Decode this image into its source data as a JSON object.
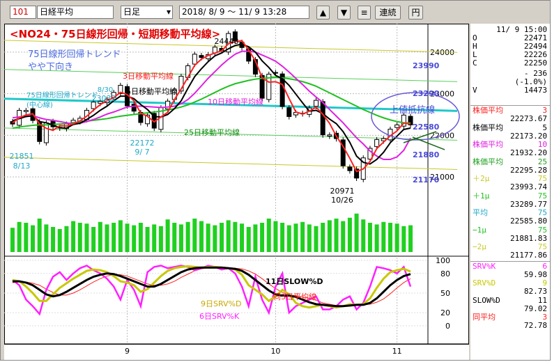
{
  "toolbar": {
    "code": "101",
    "name": "日経平均",
    "period": "日足",
    "range": "2018/ 8/ 9 〜 11/ 9 13:28",
    "up_label": "▲",
    "down_label": "▼",
    "menu_label": "≡",
    "continuous_label": "連続",
    "yen_label": "円"
  },
  "chart_titles": {
    "main": "<NO24・75日線形回帰・短期移動平均線>",
    "trend1": "75日線形回帰トレンド",
    "trend2": "やや下向き"
  },
  "annotations": {
    "ma3": "3日移動平均線",
    "ma5": "5日移動平均線",
    "ma10": "10日移動平均線",
    "ma25": "25日移動平均線",
    "reg_center1": "75日線形回帰トレンド",
    "reg_center2": "(中心線)",
    "resistance": "上値抵抗線",
    "high_price": "24448",
    "low_price": "20971",
    "low_date": "10/26",
    "p21851": "21851",
    "d0813": "8/13",
    "p23032": "23032",
    "d0830": "8/30",
    "p22172": "22172",
    "d0907": "9/ 7",
    "lvl_23990": "23990",
    "lvl_23290": "23290",
    "lvl_22580": "22580",
    "lvl_21880": "21880",
    "lvl_21170": "21170",
    "slow_d": "11日SLOW%D",
    "same3": "同3日平均線",
    "srv_d": "9日SRV%D",
    "srv_k": "6日SRV%K"
  },
  "axis": {
    "price_ticks": [
      "24000",
      "23000",
      "22000",
      "21000"
    ],
    "osc_ticks": [
      "100",
      "80",
      "50",
      "20",
      "0"
    ],
    "months": [
      "9",
      "10",
      "11"
    ]
  },
  "colors": {
    "candle_up": "#ffffff",
    "candle_down": "#000000",
    "ma3": "#ff2020",
    "ma5": "#000000",
    "ma10": "#e020e0",
    "ma25": "#20c020",
    "regression": "#20c8c8",
    "band_outer": "#c8c828",
    "band_inner": "#58d058",
    "volume": "#20d020",
    "slow_d": "#000000",
    "srv_d": "#c8c800",
    "srv_k": "#ff20ff",
    "same3": "#ff2020"
  },
  "panel": {
    "date": "11/ 9 15:00",
    "ohlc": [
      {
        "k": "O",
        "v": "22471"
      },
      {
        "k": "H",
        "v": "22494"
      },
      {
        "k": "L",
        "v": "22226"
      },
      {
        "k": "C",
        "v": "22250"
      }
    ],
    "chg": "- 236",
    "chg_pct": "(-1.0%)",
    "vol_k": "V",
    "vol": "14473",
    "items": [
      {
        "label": "株価平均",
        "period": "3",
        "value": "22273.67",
        "color": "#ff2020"
      },
      {
        "label": "株価平均",
        "period": "5",
        "value": "22173.20",
        "color": "#000000"
      },
      {
        "label": "株価平均",
        "period": "10",
        "value": "21932.20",
        "color": "#e020e0"
      },
      {
        "label": "株価平均",
        "period": "25",
        "value": "22295.28",
        "color": "#20a020"
      },
      {
        "label": "＋2μ",
        "period": "75",
        "value": "23993.74",
        "color": "#c8c828"
      },
      {
        "label": "＋1μ",
        "period": "75",
        "value": "23289.77",
        "color": "#20c020"
      },
      {
        "label": "平均",
        "period": "75",
        "value": "22585.80",
        "color": "#20a8c8"
      },
      {
        "label": "−1μ",
        "period": "75",
        "value": "21881.83",
        "color": "#20c020"
      },
      {
        "label": "−2μ",
        "period": "75",
        "value": "21177.86",
        "color": "#c8c828"
      }
    ],
    "osc": [
      {
        "label": "SRV%K",
        "period": "6",
        "value": "59.98",
        "color": "#ff20ff"
      },
      {
        "label": "SRV%D",
        "period": "9",
        "value": "82.73",
        "color": "#c8c800"
      },
      {
        "label": "SLOW%D",
        "period": "11",
        "value": "79.02",
        "color": "#000000"
      },
      {
        "label": "同平均",
        "period": "3",
        "value": "72.78",
        "color": "#ff2020"
      }
    ]
  },
  "chart_data": {
    "type": "candlestick",
    "x_months": [
      "9",
      "10",
      "11"
    ],
    "ylim": [
      20700,
      24550
    ],
    "candles_close": [
      22271,
      22600,
      22598,
      22356,
      21851,
      22298,
      22204,
      22192,
      22270,
      22362,
      22410,
      22601,
      22799,
      22813,
      22869,
      23032,
      23202,
      22707,
      22580,
      22307,
      22487,
      22172,
      22664,
      22821,
      23094,
      23420,
      23672,
      23950,
      23870,
      23940,
      24120,
      24033,
      24448,
      24270,
      24110,
      23783,
      23470,
      22891,
      23470,
      23506,
      22694,
      22450,
      22549,
      22532,
      22658,
      22841,
      22011,
      22010,
      21920,
      21268,
      21149,
      20971,
      21457,
      21687,
      21898,
      21920,
      22147,
      22250,
      22486,
      22250
    ],
    "ma3": [
      22300,
      22420,
      22490,
      22518,
      22268,
      22168,
      22118,
      22231,
      22222,
      22275,
      22347,
      22458,
      22603,
      22738,
      22827,
      22905,
      23034,
      22980,
      22830,
      22531,
      22458,
      22322,
      22441,
      22552,
      22860,
      23112,
      23395,
      23681,
      23831,
      23920,
      23977,
      24031,
      24200,
      24250,
      24276,
      24054,
      23788,
      23381,
      23278,
      23289,
      23223,
      22883,
      22564,
      22510,
      22580,
      22677,
      22503,
      22287,
      21980,
      21733,
      21446,
      21129,
      21192,
      21372,
      21681,
      21835,
      21988,
      22106,
      22294,
      22274
    ],
    "ma5": [
      22350,
      22400,
      22450,
      22470,
      22330,
      22300,
      22250,
      22180,
      22170,
      22260,
      22290,
      22380,
      22480,
      22600,
      22700,
      22830,
      22940,
      22940,
      22880,
      22740,
      22620,
      22450,
      22440,
      22500,
      22640,
      22830,
      23130,
      23410,
      23600,
      23770,
      23910,
      23980,
      24080,
      24160,
      24190,
      24130,
      24000,
      23790,
      23630,
      23440,
      23360,
      23200,
      22990,
      22780,
      22580,
      22600,
      22520,
      22390,
      22280,
      22090,
      21830,
      21500,
      21350,
      21310,
      21420,
      21590,
      21820,
      21980,
      22140,
      22173
    ],
    "ma10": [
      22420,
      22440,
      22460,
      22470,
      22420,
      22380,
      22360,
      22330,
      22300,
      22270,
      22290,
      22330,
      22380,
      22440,
      22510,
      22560,
      22620,
      22680,
      22700,
      22700,
      22690,
      22680,
      22670,
      22680,
      22700,
      22760,
      22860,
      23010,
      23190,
      23370,
      23530,
      23690,
      23830,
      23950,
      24020,
      24020,
      24000,
      23930,
      23860,
      23780,
      23660,
      23520,
      23370,
      23220,
      23060,
      22920,
      22790,
      22620,
      22460,
      22300,
      22120,
      21940,
      21790,
      21620,
      21500,
      21420,
      21420,
      21480,
      21640,
      21932
    ],
    "ma25": [
      22170,
      22200,
      22220,
      22240,
      22250,
      22250,
      22260,
      22270,
      22280,
      22300,
      22320,
      22340,
      22360,
      22380,
      22400,
      22430,
      22460,
      22480,
      22500,
      22520,
      22540,
      22560,
      22580,
      22610,
      22640,
      22680,
      22730,
      22800,
      22870,
      22950,
      23030,
      23110,
      23180,
      23240,
      23280,
      23320,
      23350,
      23370,
      23380,
      23390,
      23380,
      23360,
      23330,
      23290,
      23240,
      23180,
      23100,
      23020,
      22940,
      22860,
      22780,
      22700,
      22620,
      22550,
      22480,
      22420,
      22370,
      22330,
      22300,
      22295
    ],
    "regression": {
      "center": [
        22880,
        22586
      ],
      "plus1": [
        23584,
        23290
      ],
      "minus1": [
        22176,
        21882
      ],
      "plus2": [
        24284,
        23994
      ],
      "minus2": [
        21472,
        21178
      ]
    },
    "volume": [
      58,
      72,
      70,
      64,
      80,
      66,
      60,
      55,
      62,
      74,
      70,
      68,
      60,
      72,
      66,
      70,
      76,
      68,
      64,
      70,
      60,
      66,
      62,
      78,
      70,
      66,
      72,
      80,
      74,
      68,
      64,
      70,
      76,
      72,
      68,
      60,
      66,
      70,
      80,
      74,
      70,
      64,
      68,
      72,
      66,
      62,
      70,
      76,
      80,
      74,
      82,
      92,
      78,
      70,
      66,
      72,
      70,
      68,
      62,
      64
    ],
    "srv_k": [
      70,
      62,
      40,
      30,
      18,
      55,
      75,
      82,
      70,
      80,
      88,
      92,
      85,
      80,
      72,
      60,
      40,
      70,
      55,
      30,
      82,
      90,
      92,
      88,
      90,
      92,
      90,
      85,
      88,
      92,
      90,
      86,
      88,
      80,
      60,
      30,
      75,
      40,
      20,
      60,
      80,
      20,
      30,
      35,
      40,
      45,
      25,
      25,
      30,
      40,
      45,
      25,
      35,
      60,
      90,
      88,
      85,
      80,
      90,
      60
    ],
    "srv_d": [
      70,
      68,
      60,
      50,
      38,
      38,
      48,
      58,
      65,
      72,
      78,
      84,
      86,
      85,
      82,
      76,
      68,
      66,
      62,
      52,
      56,
      66,
      76,
      84,
      88,
      90,
      91,
      90,
      89,
      90,
      90,
      89,
      88,
      86,
      78,
      62,
      55,
      48,
      38,
      45,
      55,
      48,
      35,
      30,
      28,
      30,
      32,
      30,
      28,
      30,
      33,
      32,
      33,
      42,
      58,
      72,
      82,
      85,
      87,
      83
    ],
    "slow_d": [
      68,
      68,
      66,
      62,
      55,
      48,
      45,
      47,
      52,
      58,
      64,
      70,
      75,
      78,
      80,
      79,
      76,
      72,
      68,
      64,
      60,
      60,
      64,
      70,
      76,
      82,
      86,
      88,
      89,
      89,
      89,
      89,
      88,
      87,
      84,
      78,
      70,
      62,
      54,
      48,
      46,
      46,
      44,
      40,
      36,
      33,
      32,
      31,
      30,
      30,
      31,
      32,
      32,
      35,
      42,
      52,
      62,
      70,
      76,
      79
    ],
    "same3": [
      66,
      67,
      67,
      65,
      62,
      56,
      51,
      47,
      47,
      50,
      55,
      61,
      67,
      72,
      76,
      78,
      78,
      76,
      72,
      68,
      64,
      62,
      62,
      64,
      68,
      74,
      79,
      84,
      87,
      89,
      89,
      89,
      89,
      88,
      87,
      84,
      79,
      72,
      64,
      57,
      51,
      47,
      46,
      44,
      42,
      39,
      35,
      33,
      31,
      30,
      30,
      31,
      32,
      33,
      36,
      41,
      49,
      58,
      66,
      72
    ]
  }
}
